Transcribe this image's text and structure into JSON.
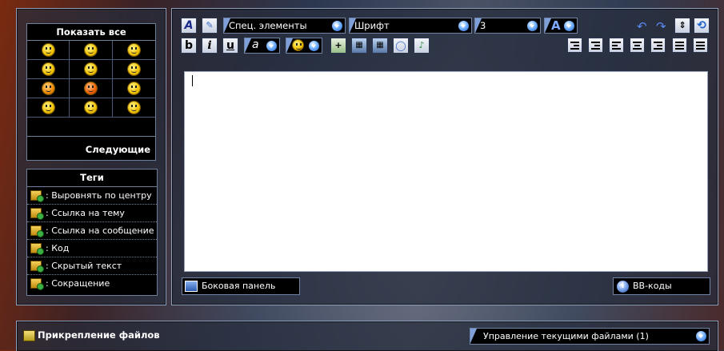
{
  "smilies": {
    "show_all": "Показать все",
    "next": "Следующие",
    "items": [
      "smile-icon",
      "grin-icon",
      "wink-icon",
      "neutral-icon",
      "confused-icon",
      "cool-icon",
      "surprised-icon",
      "exclaim-icon",
      "question-icon",
      "laugh-icon",
      "angry-icon",
      "happy-icon"
    ]
  },
  "tags": {
    "title": "Теги",
    "items": [
      ": Выровнять по центру",
      ": Ссылка на тему",
      ": Ссылка на сообщение",
      ": Код",
      ": Скрытый текст",
      ": Сокращение"
    ]
  },
  "toolbar": {
    "special": "Спец. элементы",
    "font": "Шрифт",
    "size": "3",
    "bold": "b",
    "italic": "i",
    "underline": "u"
  },
  "editor": {
    "value": ""
  },
  "bottom": {
    "sidebar": "Боковая панель",
    "bbcodes": "BB-коды"
  },
  "attach": {
    "title": "Прикрепление файлов",
    "manage": "Управление текущими файлами (1)"
  }
}
